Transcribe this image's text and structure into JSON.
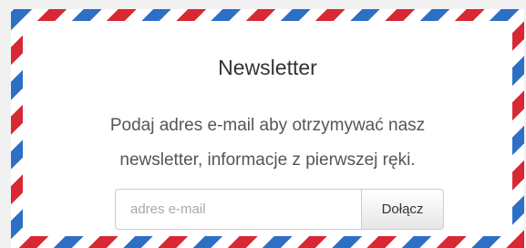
{
  "newsletter": {
    "title": "Newsletter",
    "description_line1": "Podaj adres e-mail aby otrzymywać nasz",
    "description_line2": "newsletter, informacje z pierwszej ręki.",
    "email_placeholder": "adres e-mail",
    "email_value": "",
    "join_label": "Dołącz"
  },
  "colors": {
    "page_background": "#f1f1f1",
    "stripe_red": "#d82834",
    "stripe_blue": "#2e6fc6",
    "card_background": "#ffffff"
  }
}
